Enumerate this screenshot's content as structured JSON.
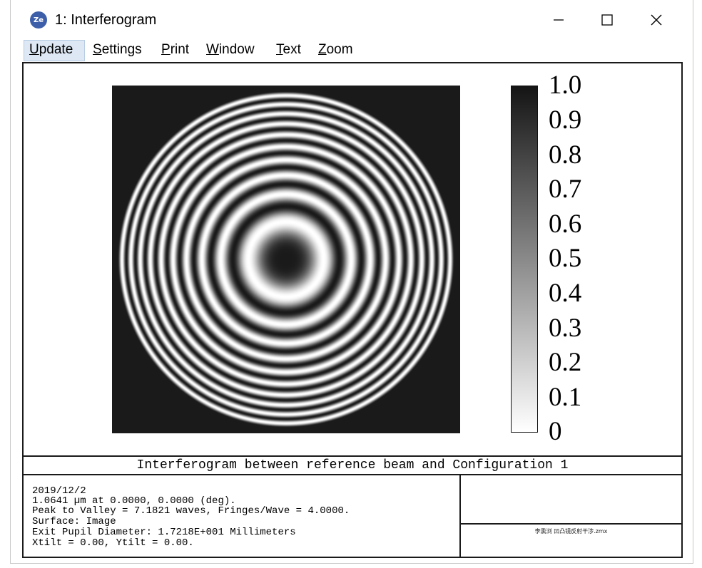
{
  "window": {
    "icon_text": "Ze",
    "title": "1: Interferogram",
    "controls": {
      "minimize": "minimize-icon",
      "maximize": "maximize-icon",
      "close": "close-icon"
    }
  },
  "menu": {
    "items": [
      {
        "label": "Update",
        "active": true
      },
      {
        "label": "Settings",
        "active": false
      },
      {
        "label": "Print",
        "active": false
      },
      {
        "label": "Window",
        "active": false
      },
      {
        "label": "Text",
        "active": false
      },
      {
        "label": "Zoom",
        "active": false
      }
    ]
  },
  "plot": {
    "fringe_count": 10,
    "background_color": "#1a1a1a"
  },
  "colorbar": {
    "ticks": [
      "1.0",
      "0.9",
      "0.8",
      "0.7",
      "0.6",
      "0.5",
      "0.4",
      "0.3",
      "0.2",
      "0.1",
      "0"
    ],
    "color_top": "#141414",
    "color_bottom": "#ffffff"
  },
  "caption": "Interferogram between reference beam and Configuration 1",
  "info": {
    "lines": [
      "2019/12/2",
      "1.0641 µm at 0.0000, 0.0000 (deg).",
      "Peak to Valley = 7.1821 waves, Fringes/Wave = 4.0000.",
      "Surface: Image",
      "Exit Pupil Diameter: 1.7218E+001 Millimeters",
      "Xtilt = 0.00, Ytilt = 0.00."
    ],
    "filename": "李熏浏 凹凸镜反射干涉.zmx"
  }
}
